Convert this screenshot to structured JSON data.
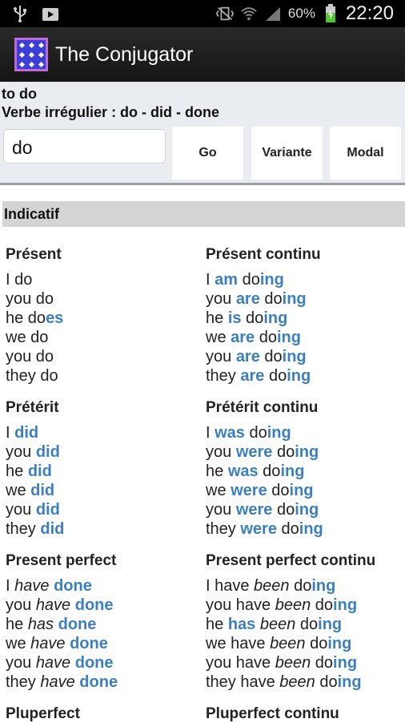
{
  "status": {
    "battery": "60%",
    "time": "22:20"
  },
  "app": {
    "title": "The Conjugator"
  },
  "header": {
    "verb": "to do",
    "info": "Verbe irrégulier : do - did - done",
    "search_value": "do",
    "buttons": [
      "Go",
      "Variante",
      "Modal"
    ]
  },
  "section": "Indicatif",
  "tenses": [
    {
      "title": "Présent",
      "lines": [
        [
          [
            "I do",
            ""
          ]
        ],
        [
          [
            "you do",
            ""
          ]
        ],
        [
          [
            "he do",
            ""
          ],
          [
            "es",
            "hl"
          ]
        ],
        [
          [
            "we do",
            ""
          ]
        ],
        [
          [
            "you do",
            ""
          ]
        ],
        [
          [
            "they do",
            ""
          ]
        ]
      ]
    },
    {
      "title": "Présent continu",
      "lines": [
        [
          [
            "I ",
            ""
          ],
          [
            "am",
            "hl"
          ],
          [
            " do",
            ""
          ],
          [
            "ing",
            "hl"
          ]
        ],
        [
          [
            "you ",
            ""
          ],
          [
            "are",
            "hl"
          ],
          [
            " do",
            ""
          ],
          [
            "ing",
            "hl"
          ]
        ],
        [
          [
            "he ",
            ""
          ],
          [
            "is",
            "hl"
          ],
          [
            " do",
            ""
          ],
          [
            "ing",
            "hl"
          ]
        ],
        [
          [
            "we ",
            ""
          ],
          [
            "are",
            "hl"
          ],
          [
            " do",
            ""
          ],
          [
            "ing",
            "hl"
          ]
        ],
        [
          [
            "you ",
            ""
          ],
          [
            "are",
            "hl"
          ],
          [
            " do",
            ""
          ],
          [
            "ing",
            "hl"
          ]
        ],
        [
          [
            "they ",
            ""
          ],
          [
            "are",
            "hl"
          ],
          [
            " do",
            ""
          ],
          [
            "ing",
            "hl"
          ]
        ]
      ]
    },
    {
      "title": "Prétérit",
      "lines": [
        [
          [
            "I ",
            ""
          ],
          [
            "did",
            "hl"
          ]
        ],
        [
          [
            "you ",
            ""
          ],
          [
            "did",
            "hl"
          ]
        ],
        [
          [
            "he ",
            ""
          ],
          [
            "did",
            "hl"
          ]
        ],
        [
          [
            "we ",
            ""
          ],
          [
            "did",
            "hl"
          ]
        ],
        [
          [
            "you ",
            ""
          ],
          [
            "did",
            "hl"
          ]
        ],
        [
          [
            "they ",
            ""
          ],
          [
            "did",
            "hl"
          ]
        ]
      ]
    },
    {
      "title": "Prétérit continu",
      "lines": [
        [
          [
            "I ",
            ""
          ],
          [
            "was",
            "hl"
          ],
          [
            " do",
            ""
          ],
          [
            "ing",
            "hl"
          ]
        ],
        [
          [
            "you ",
            ""
          ],
          [
            "were",
            "hl"
          ],
          [
            " do",
            ""
          ],
          [
            "ing",
            "hl"
          ]
        ],
        [
          [
            "he ",
            ""
          ],
          [
            "was",
            "hl"
          ],
          [
            " do",
            ""
          ],
          [
            "ing",
            "hl"
          ]
        ],
        [
          [
            "we ",
            ""
          ],
          [
            "were",
            "hl"
          ],
          [
            " do",
            ""
          ],
          [
            "ing",
            "hl"
          ]
        ],
        [
          [
            "you ",
            ""
          ],
          [
            "were",
            "hl"
          ],
          [
            " do",
            ""
          ],
          [
            "ing",
            "hl"
          ]
        ],
        [
          [
            "they ",
            ""
          ],
          [
            "were",
            "hl"
          ],
          [
            " do",
            ""
          ],
          [
            "ing",
            "hl"
          ]
        ]
      ]
    },
    {
      "title": "Present perfect",
      "lines": [
        [
          [
            "I ",
            ""
          ],
          [
            "have",
            "it"
          ],
          [
            " ",
            ""
          ],
          [
            "done",
            "hl"
          ]
        ],
        [
          [
            "you ",
            ""
          ],
          [
            "have",
            "it"
          ],
          [
            " ",
            ""
          ],
          [
            "done",
            "hl"
          ]
        ],
        [
          [
            "he ",
            ""
          ],
          [
            "has",
            "it"
          ],
          [
            " ",
            ""
          ],
          [
            "done",
            "hl"
          ]
        ],
        [
          [
            "we ",
            ""
          ],
          [
            "have",
            "it"
          ],
          [
            " ",
            ""
          ],
          [
            "done",
            "hl"
          ]
        ],
        [
          [
            "you ",
            ""
          ],
          [
            "have",
            "it"
          ],
          [
            " ",
            ""
          ],
          [
            "done",
            "hl"
          ]
        ],
        [
          [
            "they ",
            ""
          ],
          [
            "have",
            "it"
          ],
          [
            " ",
            ""
          ],
          [
            "done",
            "hl"
          ]
        ]
      ]
    },
    {
      "title": "Present perfect continu",
      "lines": [
        [
          [
            "I have ",
            ""
          ],
          [
            "been",
            "it"
          ],
          [
            " do",
            ""
          ],
          [
            "ing",
            "hl"
          ]
        ],
        [
          [
            "you have ",
            ""
          ],
          [
            "been",
            "it"
          ],
          [
            " do",
            ""
          ],
          [
            "ing",
            "hl"
          ]
        ],
        [
          [
            "he ",
            ""
          ],
          [
            "has",
            "hl"
          ],
          [
            " ",
            ""
          ],
          [
            "been",
            "it"
          ],
          [
            " do",
            ""
          ],
          [
            "ing",
            "hl"
          ]
        ],
        [
          [
            "we have ",
            ""
          ],
          [
            "been",
            "it"
          ],
          [
            " do",
            ""
          ],
          [
            "ing",
            "hl"
          ]
        ],
        [
          [
            "you have ",
            ""
          ],
          [
            "been",
            "it"
          ],
          [
            " do",
            ""
          ],
          [
            "ing",
            "hl"
          ]
        ],
        [
          [
            "they have ",
            ""
          ],
          [
            "been",
            "it"
          ],
          [
            " do",
            ""
          ],
          [
            "ing",
            "hl"
          ]
        ]
      ]
    },
    {
      "title": "Pluperfect",
      "lines": []
    },
    {
      "title": "Pluperfect continu",
      "lines": []
    }
  ]
}
